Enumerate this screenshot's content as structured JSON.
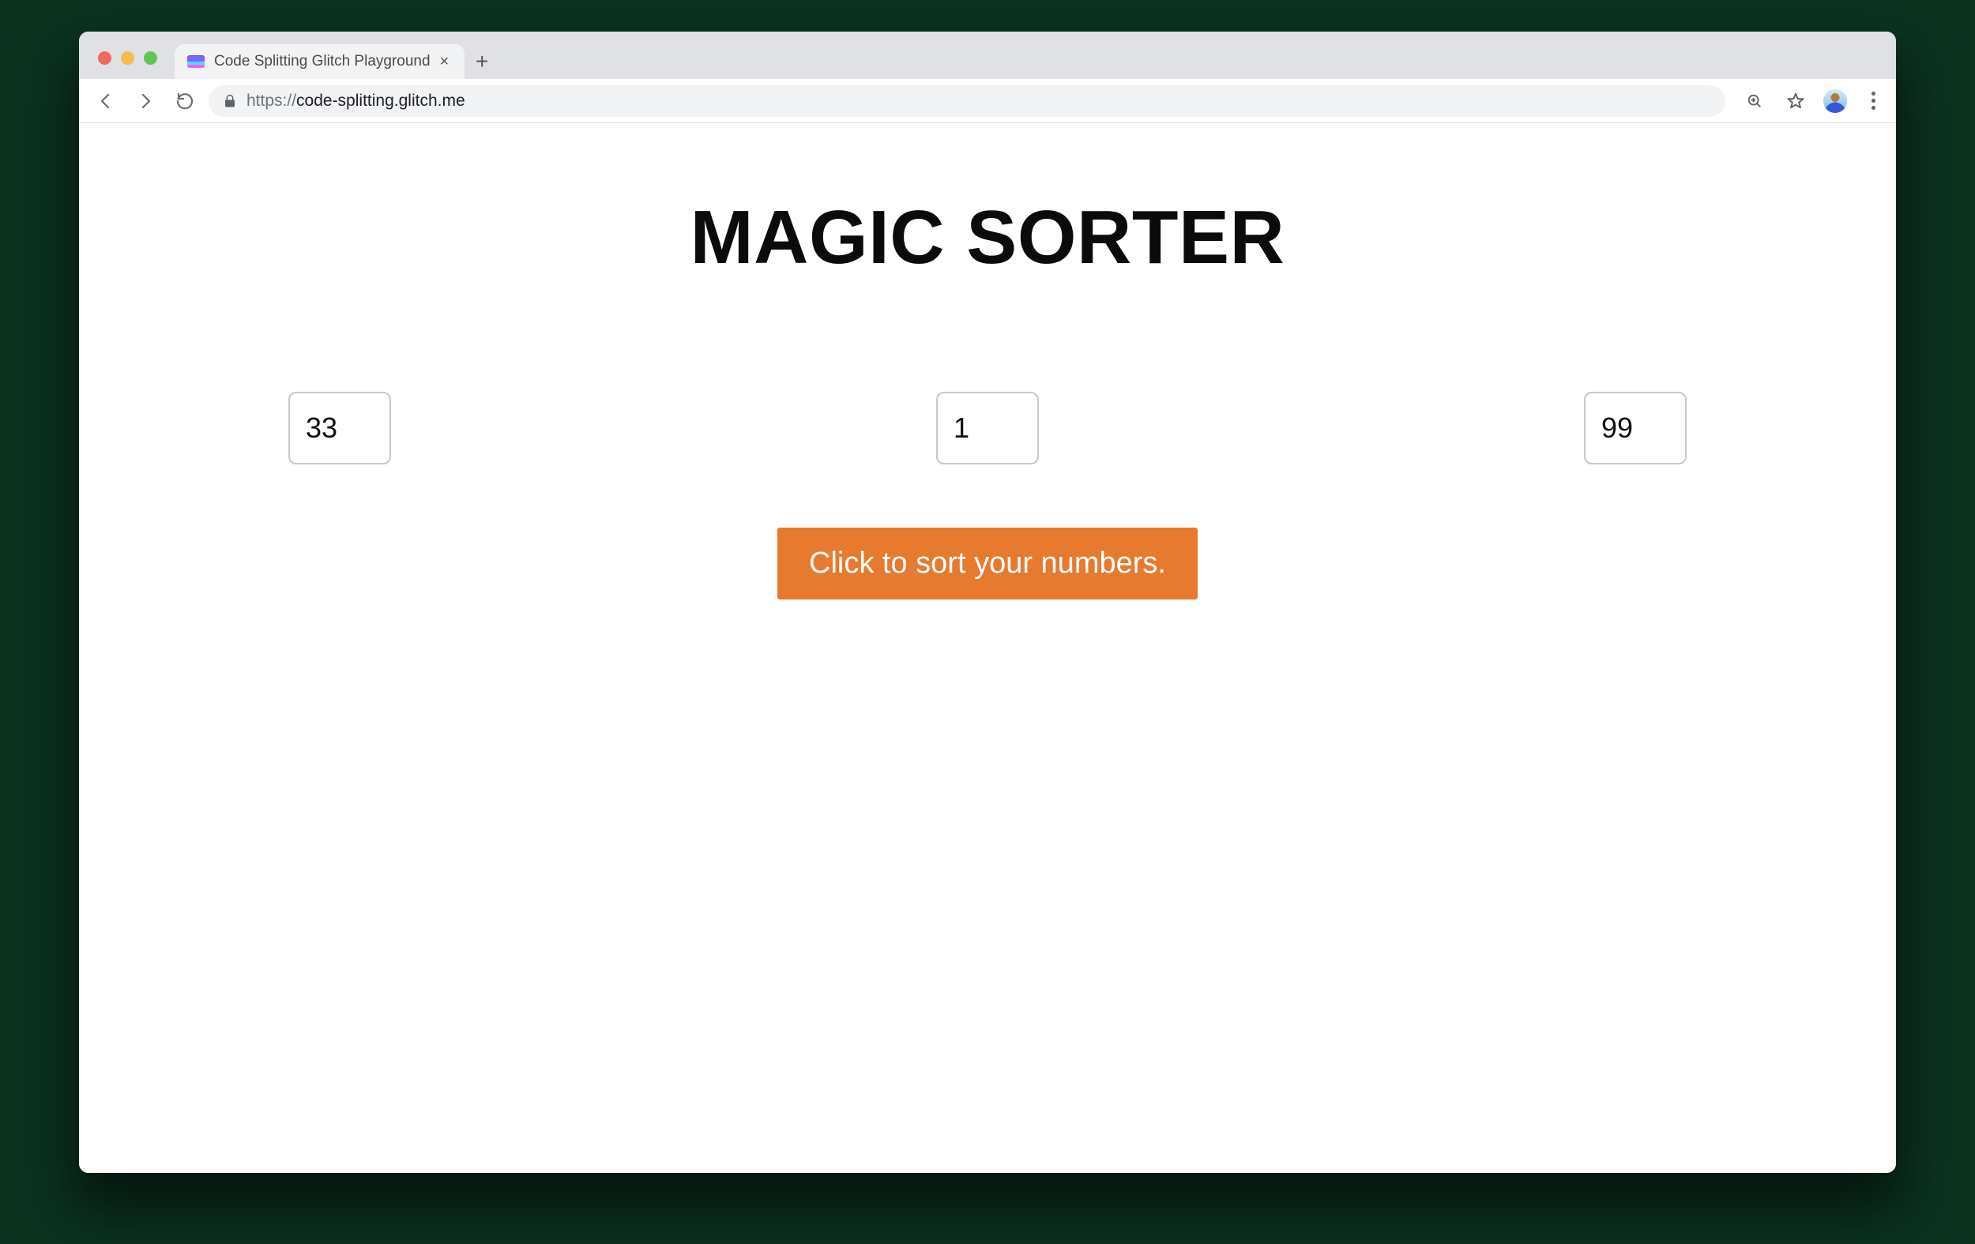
{
  "browser": {
    "traffic_colors": {
      "close": "#ee6a5f",
      "min": "#f5bd4f",
      "max": "#61c454"
    },
    "tab": {
      "title": "Code Splitting Glitch Playground"
    },
    "url": {
      "scheme": "https://",
      "host": "code-splitting.glitch.me",
      "path": ""
    }
  },
  "page": {
    "heading": "MAGIC SORTER",
    "inputs": {
      "a": "33",
      "b": "1",
      "c": "99"
    },
    "sort_btn": "Click to sort your numbers."
  },
  "colors": {
    "accent": "#e67a2e"
  }
}
